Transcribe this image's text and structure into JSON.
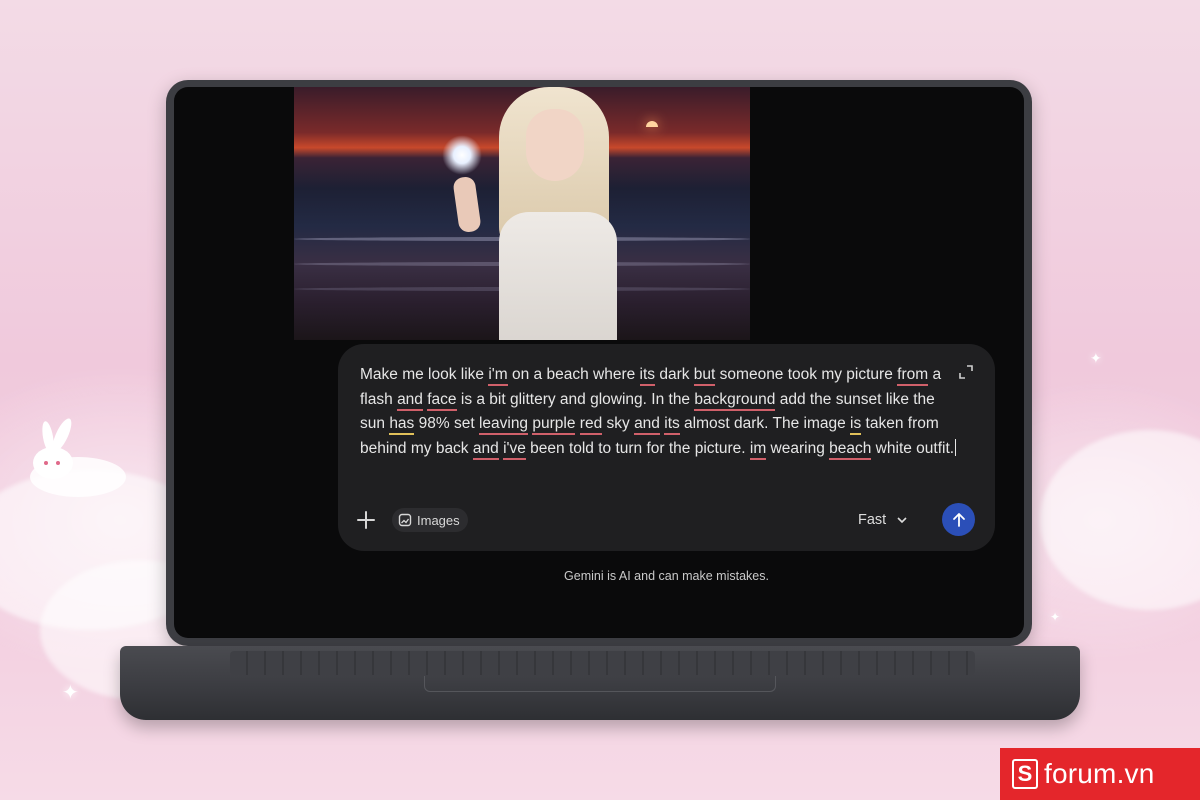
{
  "prompt": {
    "segments": [
      {
        "t": "Make me look like ",
        "m": "none"
      },
      {
        "t": "i'm",
        "m": "error"
      },
      {
        "t": " on a beach where ",
        "m": "none"
      },
      {
        "t": "its",
        "m": "error"
      },
      {
        "t": " dark ",
        "m": "none"
      },
      {
        "t": "but",
        "m": "error"
      },
      {
        "t": " someone took my picture ",
        "m": "none"
      },
      {
        "t": "from",
        "m": "error"
      },
      {
        "t": " a flash ",
        "m": "none"
      },
      {
        "t": "and",
        "m": "error"
      },
      {
        "t": " ",
        "m": "none"
      },
      {
        "t": "face",
        "m": "error"
      },
      {
        "t": " is a bit glittery and glowing. In the ",
        "m": "none"
      },
      {
        "t": "background",
        "m": "error"
      },
      {
        "t": " add the sunset like the sun ",
        "m": "none"
      },
      {
        "t": "has",
        "m": "warn"
      },
      {
        "t": " 98% set ",
        "m": "none"
      },
      {
        "t": "leaving",
        "m": "error"
      },
      {
        "t": " ",
        "m": "none"
      },
      {
        "t": "purple",
        "m": "error"
      },
      {
        "t": " ",
        "m": "none"
      },
      {
        "t": "red",
        "m": "error"
      },
      {
        "t": " sky ",
        "m": "none"
      },
      {
        "t": "and",
        "m": "error"
      },
      {
        "t": " ",
        "m": "none"
      },
      {
        "t": "its",
        "m": "error"
      },
      {
        "t": " almost dark. The image ",
        "m": "none"
      },
      {
        "t": "is",
        "m": "warn"
      },
      {
        "t": " taken from behind my back ",
        "m": "none"
      },
      {
        "t": "and",
        "m": "error"
      },
      {
        "t": " ",
        "m": "none"
      },
      {
        "t": "i've",
        "m": "error"
      },
      {
        "t": " been told to turn for the picture. ",
        "m": "none"
      },
      {
        "t": "im",
        "m": "error"
      },
      {
        "t": " wearing ",
        "m": "none"
      },
      {
        "t": "beach",
        "m": "error"
      },
      {
        "t": " white outfit.",
        "m": "none"
      }
    ]
  },
  "toolbar": {
    "images_label": "Images",
    "model_label": "Fast"
  },
  "disclaimer": "Gemini is AI and can make mistakes.",
  "brand": {
    "logo_letter": "S",
    "logo_text": "forum.vn",
    "color": "#e4262b"
  },
  "colors": {
    "send_button": "#2b4fb8",
    "spell_error_underline": "#d0606a",
    "grammar_warn_underline": "#e0c05a"
  }
}
